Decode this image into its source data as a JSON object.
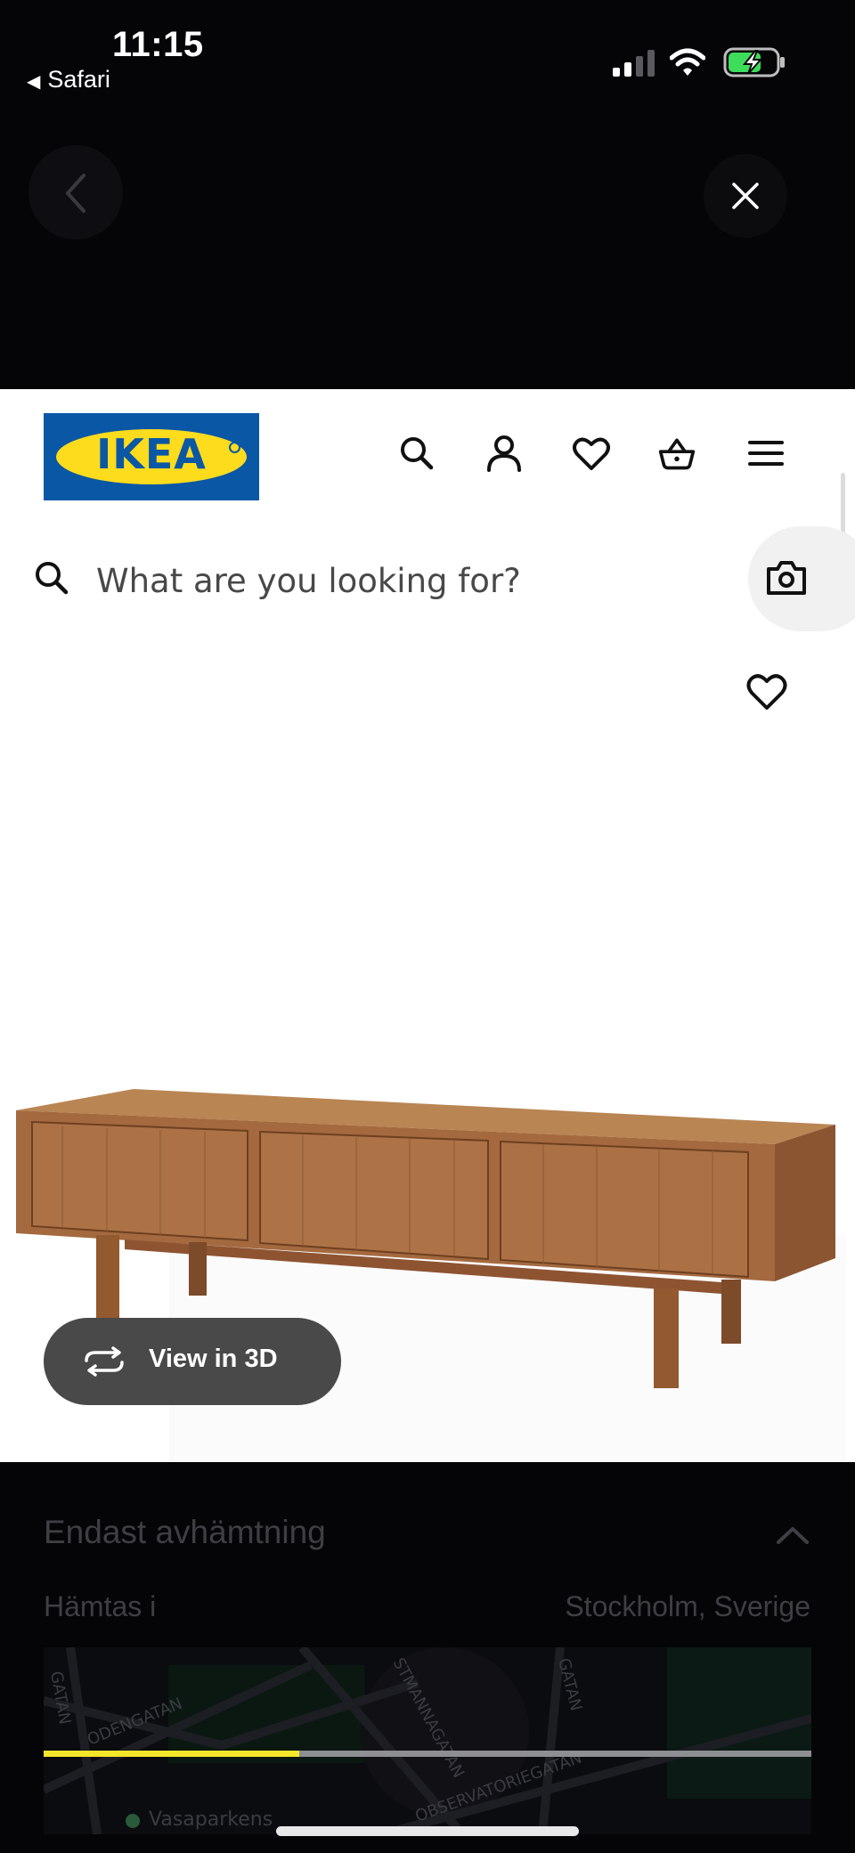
{
  "status_bar": {
    "time": "11:15",
    "back_app": "Safari"
  },
  "header": {
    "logo_text": "IKEA",
    "icons": [
      "search-icon",
      "user-icon",
      "heart-icon",
      "basket-icon",
      "menu-icon"
    ]
  },
  "search": {
    "placeholder": "What are you looking for?",
    "value": ""
  },
  "product": {
    "view_3d_label": "View in 3D"
  },
  "delivery": {
    "title": "Endast avhämtning",
    "pickup_label": "Hämtas i",
    "pickup_location": "Stockholm, Sverige",
    "map_labels": [
      "GATAN",
      "ODENGATAN",
      "STMANNAGATAN",
      "GATAN",
      "OBSERVATORIEGATAN",
      "Vasaparkens"
    ]
  },
  "progress": {
    "fraction": 0.333
  },
  "colors": {
    "ikea_blue": "#0a57a6",
    "ikea_yellow": "#fddb1d",
    "progress_yellow": "#f5e62b",
    "view3d_bg": "#494949"
  }
}
